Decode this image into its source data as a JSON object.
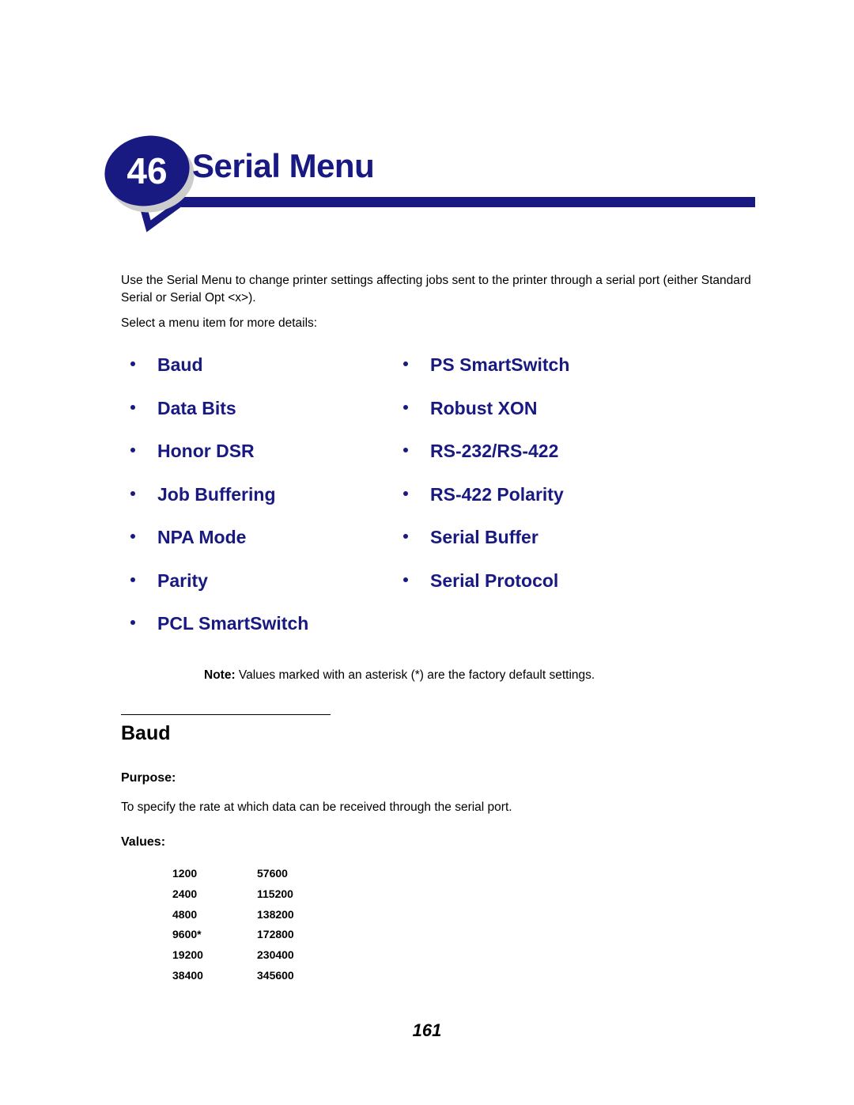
{
  "header": {
    "badge_number": "46",
    "title": "Serial Menu",
    "accent_color": "#191982",
    "badge_shadow_color": "#cccccc"
  },
  "intro": {
    "paragraph": "Use the Serial Menu to change printer settings affecting jobs sent to the printer through a serial port (either Standard Serial or Serial Opt <x>).",
    "select_line": "Select a menu item for more details:"
  },
  "menu_links": {
    "left_column": [
      {
        "label": "Baud"
      },
      {
        "label": "Data Bits"
      },
      {
        "label": "Honor DSR"
      },
      {
        "label": "Job Buffering"
      },
      {
        "label": "NPA Mode"
      },
      {
        "label": "Parity"
      },
      {
        "label": "PCL SmartSwitch"
      }
    ],
    "right_column": [
      {
        "label": "PS SmartSwitch"
      },
      {
        "label": "Robust XON"
      },
      {
        "label": "RS-232/RS-422"
      },
      {
        "label": "RS-422 Polarity"
      },
      {
        "label": "Serial Buffer"
      },
      {
        "label": "Serial Protocol"
      }
    ]
  },
  "note": {
    "label": "Note:",
    "text": " Values marked with an asterisk (*) are the factory default settings."
  },
  "section": {
    "title": "Baud",
    "purpose_label": "Purpose:",
    "purpose_text": "To specify the rate at which data can be received through the serial port.",
    "values_label": "Values:",
    "values_rows": [
      [
        "1200",
        "57600"
      ],
      [
        "2400",
        "115200"
      ],
      [
        "4800",
        "138200"
      ],
      [
        "9600*",
        "172800"
      ],
      [
        "19200",
        "230400"
      ],
      [
        "38400",
        "345600"
      ]
    ]
  },
  "footer": {
    "page_number": "161"
  }
}
